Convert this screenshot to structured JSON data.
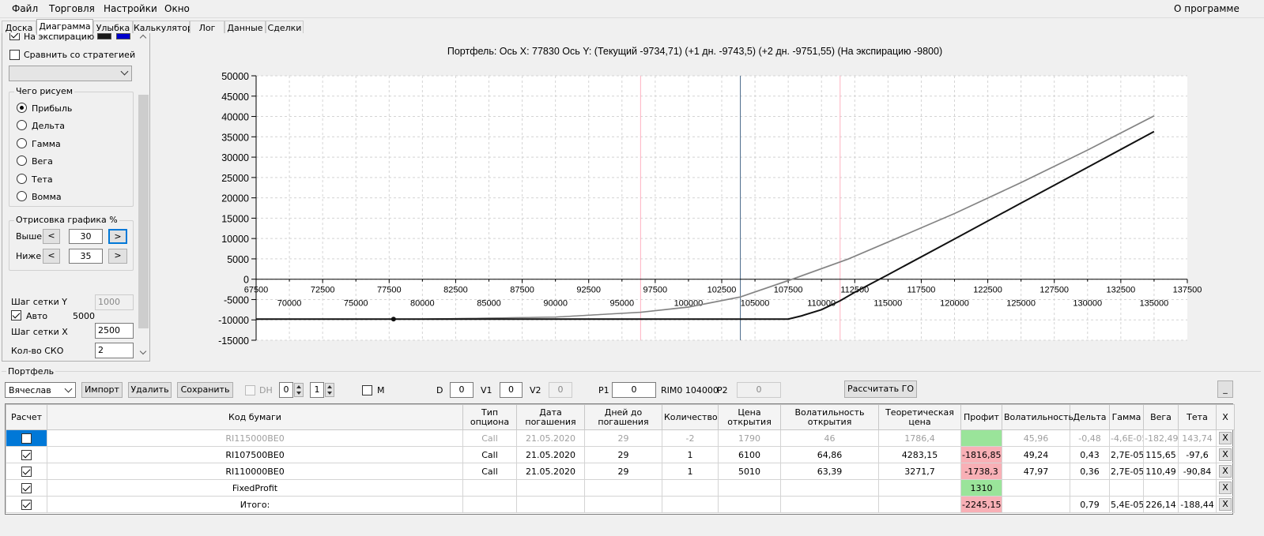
{
  "menu": {
    "file": "Файл",
    "trade": "Торговля",
    "settings": "Настройки",
    "window": "Окно",
    "about": "О программе"
  },
  "tabs": [
    "Доска",
    "Диаграмма",
    "Улыбка",
    "Калькулятор",
    "Лог",
    "Данные",
    "Сделки"
  ],
  "left": {
    "expiry_label": "На экспирацию",
    "compare_label": "Сравнить со стратегией",
    "draw_group": "Чего рисуем",
    "radios": [
      "Прибыль",
      "Дельта",
      "Гамма",
      "Вега",
      "Тета",
      "Вомма"
    ],
    "render_group": "Отрисовка графика %",
    "above_label": "Выше",
    "above_value": "30",
    "below_label": "Ниже",
    "below_value": "35",
    "step_y_label": "Шаг сетки Y",
    "step_y_value": "1000",
    "auto_label": "Авто",
    "auto_value": "5000",
    "step_x_label": "Шаг сетки X",
    "step_x_value": "2500",
    "sko_label": "Кол-во СКО",
    "sko_value": "2",
    "prev": "<",
    "next": ">",
    "swatch_colors": [
      "#1a1a1a",
      "#0000cc"
    ]
  },
  "chart_data": {
    "type": "line",
    "title": "Портфель: Ось X: 77830 Ось Y:  (Текущий -9734,71)  (+1 дн. -9743,5)  (+2 дн. -9751,55)  (На экспирацию -9800)",
    "xlim": [
      67500,
      137500
    ],
    "ylim": [
      -15000,
      50000
    ],
    "y_ticks": [
      "50000",
      "45000",
      "40000",
      "35000",
      "30000",
      "25000",
      "20000",
      "15000",
      "10000",
      "5000",
      "0",
      "-5000",
      "-10000",
      "-15000"
    ],
    "x_ticks_upper": [
      "67500",
      "72500",
      "77500",
      "82500",
      "87500",
      "92500",
      "97500",
      "102500",
      "107500",
      "112500",
      "117500",
      "122500",
      "127500",
      "132500",
      "137500"
    ],
    "x_ticks_lower": [
      "70000",
      "75000",
      "80000",
      "85000",
      "90000",
      "95000",
      "100000",
      "105000",
      "110000",
      "115000",
      "120000",
      "125000",
      "130000",
      "135000"
    ],
    "vlines": [
      {
        "x": 96400,
        "color": "#ffb0c0"
      },
      {
        "x": 103900,
        "color": "#4a6a8a"
      },
      {
        "x": 111400,
        "color": "#ffb0c0"
      }
    ],
    "marker": {
      "x": 77830,
      "y": -9800
    },
    "series": [
      {
        "color": "#a0a0a0",
        "x": [
          67500,
          80000,
          90000,
          96400,
          100000,
          103900,
          108000,
          112000,
          116000,
          120000,
          125000,
          130000,
          135000
        ],
        "y": [
          -9800,
          -9800,
          -9300,
          -8100,
          -6800,
          -4300,
          300,
          5000,
          10600,
          16200,
          23800,
          31800,
          40200
        ]
      },
      {
        "color": "#808080",
        "x": [
          67500,
          80000,
          90000,
          96400,
          100000,
          103900,
          108000,
          112000,
          116000,
          120000,
          125000,
          130000,
          135000
        ],
        "y": [
          -9800,
          -9800,
          -9320,
          -8160,
          -6880,
          -4400,
          200,
          4900,
          10500,
          16100,
          23700,
          31700,
          40100
        ]
      },
      {
        "color": "#111111",
        "x": [
          67500,
          107500,
          108500,
          110000,
          111400,
          112500,
          115000,
          120000,
          125000,
          130000,
          135000
        ],
        "y": [
          -9800,
          -9800,
          -9000,
          -7500,
          -5300,
          -3200,
          1100,
          9900,
          18700,
          27500,
          36300
        ]
      }
    ]
  },
  "portfolio": {
    "title": "Портфель",
    "account": "Вячеслав",
    "import": "Импорт",
    "delete": "Удалить",
    "save": "Сохранить",
    "dh": "DH",
    "dh_v1": "0",
    "dh_v2": "1",
    "m": "M",
    "d_label": "D",
    "d_value": "0",
    "v1_label": "V1",
    "v1_value": "0",
    "v2_label": "V2",
    "v2_value": "0",
    "p1_label": "P1",
    "p1_value": "0",
    "rim": "RIM0 104000",
    "p2_label": "P2",
    "p2_value": "0",
    "calc_go": "Рассчитать ГО",
    "minimize": "_",
    "columns": [
      "Расчет",
      "Код бумаги",
      "Тип опциона",
      "Дата погашения",
      "Дней до погашения",
      "Количество",
      "Цена открытия",
      "Волатильность открытия",
      "Теоретическая цена",
      "Профит",
      "Волатильность",
      "Дельта",
      "Гамма",
      "Вега",
      "Тета",
      "X"
    ],
    "rows": [
      [
        "RI115000BE0",
        "Call",
        "21.05.2020",
        "29",
        "-2",
        "1790",
        "46",
        "1786,4",
        "",
        "45,96",
        "-0,48",
        "-4,6E-05",
        "-182,49",
        "143,74",
        "X"
      ],
      [
        "RI107500BE0",
        "Call",
        "21.05.2020",
        "29",
        "1",
        "6100",
        "64,86",
        "4283,15",
        "-1816,85",
        "49,24",
        "0,43",
        "2,7E-05",
        "115,65",
        "-97,6",
        "X"
      ],
      [
        "RI110000BE0",
        "Call",
        "21.05.2020",
        "29",
        "1",
        "5010",
        "63,39",
        "3271,7",
        "-1738,3",
        "47,97",
        "0,36",
        "2,7E-05",
        "110,49",
        "-90,84",
        "X"
      ],
      [
        "FixedProfit",
        "",
        "",
        "",
        "",
        "",
        "",
        "",
        "1310",
        "",
        "",
        "",
        "",
        "",
        "X"
      ],
      [
        "Итого:",
        "",
        "",
        "",
        "",
        "",
        "",
        "",
        "-2245,15",
        "",
        "0,79",
        "5,4E-05",
        "226,14",
        "-188,44",
        "X"
      ]
    ],
    "colors": {
      "selected": "#0078d7",
      "loss": "#f8b0b6",
      "gain": "#9ae49a"
    }
  }
}
